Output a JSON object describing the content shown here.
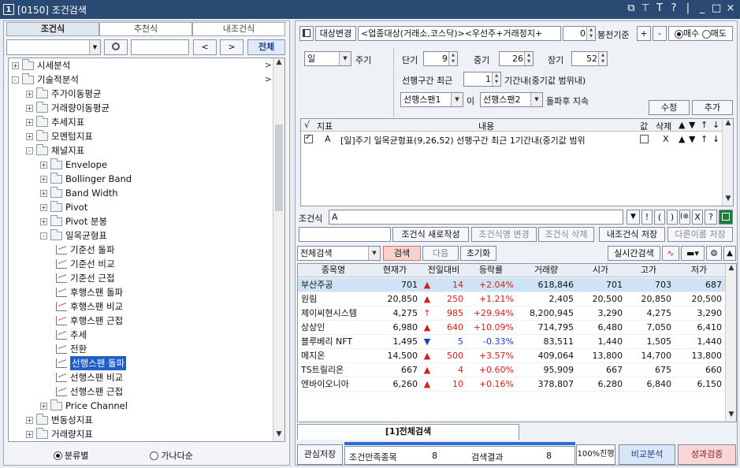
{
  "window": {
    "number": "1",
    "title": "[0150] 조건검색",
    "ctrl_icons": [
      "⧉",
      "⊤",
      "T",
      "?",
      "|",
      "_",
      "□",
      "×"
    ]
  },
  "left": {
    "tabs": [
      "조건식",
      "추천식",
      "내조건식"
    ],
    "prev_btn": "<",
    "next_btn": ">",
    "all_btn": "전체",
    "tree": [
      {
        "label": "시세분석",
        "level": 0,
        "type": "folder",
        "pm": "+",
        "arrow": ">"
      },
      {
        "label": "기술적분석",
        "level": 0,
        "type": "folder",
        "pm": "-",
        "arrow": ">"
      },
      {
        "label": "주가이동평균",
        "level": 1,
        "type": "folder",
        "pm": "+"
      },
      {
        "label": "거래량이동평균",
        "level": 1,
        "type": "folder",
        "pm": "+"
      },
      {
        "label": "추세지표",
        "level": 1,
        "type": "folder",
        "pm": "+"
      },
      {
        "label": "모멘텀지표",
        "level": 1,
        "type": "folder",
        "pm": "+"
      },
      {
        "label": "채널지표",
        "level": 1,
        "type": "folder",
        "pm": "-"
      },
      {
        "label": "Envelope",
        "level": 2,
        "type": "folder",
        "pm": "+"
      },
      {
        "label": "Bollinger Band",
        "level": 2,
        "type": "folder",
        "pm": "+"
      },
      {
        "label": "Band Width",
        "level": 2,
        "type": "folder",
        "pm": "+"
      },
      {
        "label": "Pivot",
        "level": 2,
        "type": "folder",
        "pm": "+"
      },
      {
        "label": "Pivot 분봉",
        "level": 2,
        "type": "folder",
        "pm": "+"
      },
      {
        "label": "일목균형표",
        "level": 2,
        "type": "folder",
        "pm": "-"
      },
      {
        "label": "기준선 돌파",
        "level": 3,
        "type": "item"
      },
      {
        "label": "기준선 비교",
        "level": 3,
        "type": "item"
      },
      {
        "label": "기준선 근접",
        "level": 3,
        "type": "item"
      },
      {
        "label": "후행스팬 돌파",
        "level": 3,
        "type": "item"
      },
      {
        "label": "후행스팬 비교",
        "level": 3,
        "type": "item"
      },
      {
        "label": "후행스팬 근접",
        "level": 3,
        "type": "item"
      },
      {
        "label": "추세",
        "level": 3,
        "type": "item"
      },
      {
        "label": "전환",
        "level": 3,
        "type": "item"
      },
      {
        "label": "선행스팬 돌파",
        "level": 3,
        "type": "item",
        "selected": true
      },
      {
        "label": "선행스팬 비교",
        "level": 3,
        "type": "item"
      },
      {
        "label": "선행스팬 근접",
        "level": 3,
        "type": "item"
      },
      {
        "label": "Price Channel",
        "level": 2,
        "type": "folder",
        "pm": "+"
      },
      {
        "label": "변동성지표",
        "level": 1,
        "type": "folder",
        "pm": "+"
      },
      {
        "label": "거래량지표",
        "level": 1,
        "type": "folder",
        "pm": "+"
      }
    ],
    "radio_category": "분류별",
    "radio_alpha": "가나다순"
  },
  "top": {
    "target_change": "대상변경",
    "target_text": "<업종대상(거래소,코스닥)><우선주+거래정지+",
    "bong_value": "0",
    "bong_label": "봉전기준",
    "plus": "+",
    "minus": "-",
    "buy": "매수",
    "sell": "매도"
  },
  "params": {
    "period_value": "일",
    "period_label": "주기",
    "short_label": "단기",
    "short_value": "9",
    "mid_label": "중기",
    "mid_value": "26",
    "long_label": "장기",
    "long_value": "52",
    "lead_prefix": "선행구간 최근",
    "lead_value": "1",
    "lead_suffix": "기간내(중기값 범위내)",
    "span1": "선행스팬1",
    "i_label": "이",
    "span2": "선행스팬2",
    "breakout": "돌파후 지속",
    "edit_btn": "수정",
    "add_btn": "추가"
  },
  "cond_grid": {
    "headers": [
      "√",
      "지표",
      "내용",
      "값",
      "삭제",
      "▲",
      "▼",
      "↑",
      "↓"
    ],
    "rows": [
      {
        "id": "A",
        "content": "[일]주기 일목균형표(9,26,52) 선행구간 최근 1기간내(중기값 범위",
        "del": "X",
        "up": "▲",
        "down": "▼",
        "top": "↑",
        "bottom": "↓"
      }
    ]
  },
  "formula": {
    "label": "조건식",
    "value": "A",
    "syms": [
      "!",
      "(",
      ")",
      "(⊗)",
      "X",
      "?"
    ]
  },
  "actions": {
    "new_write": "조건식 새로작성",
    "rename": "조건식명 변경",
    "delete": "조건식 삭제",
    "save_mine": "내조건식 저장",
    "save_as": "다른이름 저장"
  },
  "search": {
    "scope": "전체검색",
    "search_btn": "검색",
    "next_btn": "다음",
    "reset_btn": "초기화",
    "realtime_btn": "실시간검색"
  },
  "results": {
    "headers": [
      "종목명",
      "현재가",
      "전일대비",
      "등락률",
      "거래량",
      "시가",
      "고가",
      "저가"
    ],
    "rows": [
      {
        "name": "부산주공",
        "price": "701",
        "dir": "▲",
        "change": "14",
        "rate": "+2.04%",
        "volume": "618,846",
        "open": "701",
        "high": "703",
        "low": "687",
        "cls": "up"
      },
      {
        "name": "원림",
        "price": "20,850",
        "dir": "▲",
        "change": "250",
        "rate": "+1.21%",
        "volume": "2,405",
        "open": "20,500",
        "high": "20,850",
        "low": "20,500",
        "cls": "up"
      },
      {
        "name": "제이씨현시스템",
        "price": "4,275",
        "dir": "↑",
        "change": "985",
        "rate": "+29.94%",
        "volume": "8,200,945",
        "open": "3,290",
        "high": "4,275",
        "low": "3,290",
        "cls": "up"
      },
      {
        "name": "상상인",
        "price": "6,980",
        "dir": "▲",
        "change": "640",
        "rate": "+10.09%",
        "volume": "714,795",
        "open": "6,480",
        "high": "7,050",
        "low": "6,410",
        "cls": "up"
      },
      {
        "name": "블루베리 NFT",
        "price": "1,495",
        "dir": "▼",
        "change": "5",
        "rate": "-0.33%",
        "volume": "83,511",
        "open": "1,440",
        "high": "1,505",
        "low": "1,440",
        "cls": "dn"
      },
      {
        "name": "메지온",
        "price": "14,500",
        "dir": "▲",
        "change": "500",
        "rate": "+3.57%",
        "volume": "409,064",
        "open": "13,800",
        "high": "14,700",
        "low": "13,800",
        "cls": "up"
      },
      {
        "name": "TS트릴리온",
        "price": "667",
        "dir": "▲",
        "change": "4",
        "rate": "+0.60%",
        "volume": "95,909",
        "open": "667",
        "high": "675",
        "low": "660",
        "cls": "up"
      },
      {
        "name": "엔바이오니아",
        "price": "6,260",
        "dir": "▲",
        "change": "10",
        "rate": "+0.16%",
        "volume": "378,807",
        "open": "6,280",
        "high": "6,840",
        "low": "6,150",
        "cls": "up"
      }
    ]
  },
  "bottom": {
    "result_tab": "[1]전체검색",
    "watch_save": "관심저장",
    "match_label": "조건만족종목",
    "match_count": "8",
    "result_label": "검색결과",
    "result_count": "8",
    "progress_text": "100%진행",
    "progress": 1.0,
    "compare_btn": "비교분석",
    "verify_btn": "성과검증"
  },
  "colors": {
    "titlebar": "#2b4a73",
    "up": "#d91e18",
    "down": "#1a3fc9",
    "selected": "#1f5fc7"
  }
}
